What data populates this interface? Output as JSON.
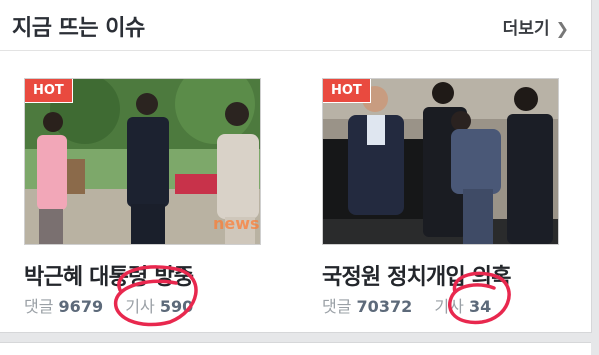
{
  "section": {
    "title": "지금 뜨는 이슈",
    "more_label": "더보기"
  },
  "items": [
    {
      "badge": "HOT",
      "headline": "박근혜 대통령 방중",
      "comments_label": "댓글",
      "comments": "9679",
      "articles_label": "기사",
      "articles": "590",
      "watermark": "news Nocut"
    },
    {
      "badge": "HOT",
      "headline": "국정원 정치개입 의혹",
      "comments_label": "댓글",
      "comments": "70372",
      "articles_label": "기사",
      "articles": "34"
    }
  ],
  "colors": {
    "hot_badge": "#e94a3f",
    "annotation": "#e8284e",
    "stat_value": "#5d6a7a"
  },
  "icons": {
    "more": "chevron-right-icon"
  }
}
